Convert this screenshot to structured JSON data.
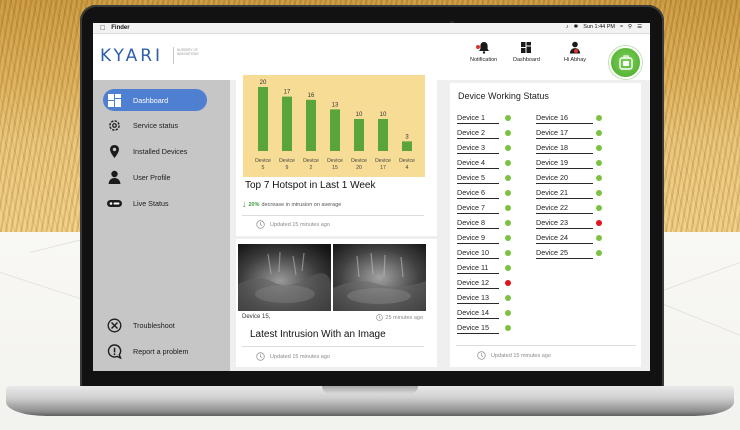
{
  "menubar": {
    "app_name": "Finder",
    "status": [
      "Sun 1:44 PM"
    ]
  },
  "header": {
    "logo": "KYARI",
    "tagline": "Nursery of innovations",
    "buttons": [
      {
        "label": "Notification",
        "icon": "bell-icon"
      },
      {
        "label": "Dashboard",
        "icon": "grid-icon"
      },
      {
        "label": "Hi Abhay",
        "icon": "user-icon"
      }
    ],
    "accent": "#2f5ea8"
  },
  "sidebar": {
    "items": [
      {
        "label": "Dashboard",
        "icon": "dashboard-icon",
        "active": true
      },
      {
        "label": "Service status",
        "icon": "gear-icon"
      },
      {
        "label": "Installed Devices",
        "icon": "location-pin-icon"
      },
      {
        "label": "User Profile",
        "icon": "user-icon"
      },
      {
        "label": "Live Status",
        "icon": "live-badge-icon"
      }
    ],
    "bottom_items": [
      {
        "label": "Troubleshoot",
        "icon": "wrench-icon"
      },
      {
        "label": "Report a problem",
        "icon": "alert-icon"
      }
    ]
  },
  "hotspot_card": {
    "title": "Top 7 Hotspot in Last 1 Week",
    "trend_percent": "20%",
    "trend_text": "decrease in intrusion on average",
    "updated": "Updated 15 minutes ago"
  },
  "chart_data": {
    "type": "bar",
    "categories": [
      "Device 5",
      "Device 9",
      "Device 2",
      "Device 15",
      "Device 20",
      "Device 17",
      "Device 4"
    ],
    "category_lines": [
      [
        "Device",
        "5"
      ],
      [
        "Device",
        "9"
      ],
      [
        "Device",
        "2"
      ],
      [
        "Device",
        "15"
      ],
      [
        "Device",
        "20"
      ],
      [
        "Device",
        "17"
      ],
      [
        "Device",
        "4"
      ]
    ],
    "values": [
      20,
      17,
      16,
      13,
      10,
      10,
      3
    ],
    "title": "",
    "xlabel": "",
    "ylabel": "",
    "ylim": [
      0,
      20
    ],
    "bar_color": "#5aa53b",
    "background": "#f7dc96"
  },
  "intrusion_card": {
    "device": "Device 15,",
    "time": "25 minutes ago",
    "title": "Latest Intrusion With an Image",
    "updated": "Updated 15 minutes ago"
  },
  "device_status": {
    "title": "Device Working Status",
    "columns": [
      [
        {
          "name": "Device 1",
          "status": "ok"
        },
        {
          "name": "Device 2",
          "status": "ok"
        },
        {
          "name": "Device 3",
          "status": "ok"
        },
        {
          "name": "Device 4",
          "status": "ok"
        },
        {
          "name": "Device 5",
          "status": "ok"
        },
        {
          "name": "Device 6",
          "status": "ok"
        },
        {
          "name": "Device 7",
          "status": "ok"
        },
        {
          "name": "Device 8",
          "status": "ok"
        },
        {
          "name": "Device 9",
          "status": "ok"
        },
        {
          "name": "Device 10",
          "status": "ok"
        },
        {
          "name": "Device 11",
          "status": "ok"
        },
        {
          "name": "Device 12",
          "status": "down"
        },
        {
          "name": "Device 13",
          "status": "ok"
        },
        {
          "name": "Device 14",
          "status": "ok"
        },
        {
          "name": "Device 15",
          "status": "ok"
        }
      ],
      [
        {
          "name": "Device 16",
          "status": "ok"
        },
        {
          "name": "Device 17",
          "status": "ok"
        },
        {
          "name": "Device 18",
          "status": "ok"
        },
        {
          "name": "Device 19",
          "status": "ok"
        },
        {
          "name": "Device 20",
          "status": "ok"
        },
        {
          "name": "Device 21",
          "status": "ok"
        },
        {
          "name": "Device 22",
          "status": "ok"
        },
        {
          "name": "Device 23",
          "status": "down"
        },
        {
          "name": "Device 24",
          "status": "ok"
        },
        {
          "name": "Device 25",
          "status": "ok"
        }
      ]
    ],
    "updated": "Updated 15 minutes ago",
    "ok_color": "#7cc242",
    "down_color": "#e0141b"
  }
}
